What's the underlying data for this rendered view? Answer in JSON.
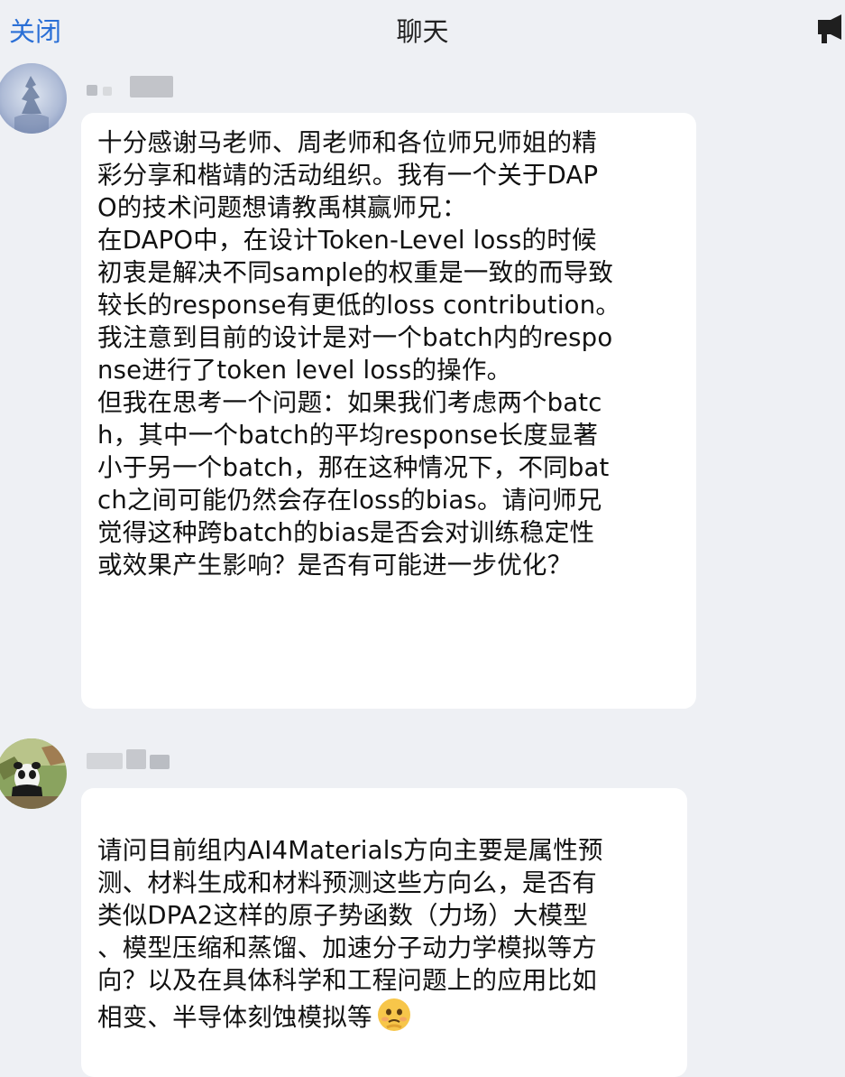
{
  "header": {
    "close_label": "关闭",
    "title": "聊天",
    "right_icon": "speaker-icon"
  },
  "messages": [
    {
      "avatar_icon": "avatar-image",
      "text": "十分感谢马老师、周老师和各位师兄师姐的精\n彩分享和楷靖的活动组织。我有一个关于DAP\nO的技术问题想请教禹棋赢师兄：\n在DAPO中，在设计Token-Level loss的时候\n初衷是解决不同sample的权重是一致的而导致\n较长的response有更低的loss contribution。\n我注意到目前的设计是对一个batch内的respo\nnse进行了token level loss的操作。\n但我在思考一个问题：如果我们考虑两个batc\nh，其中一个batch的平均response长度显著\n小于另一个batch，那在这种情况下，不同bat\nch之间可能仍然会存在loss的bias。请问师兄\n觉得这种跨batch的bias是否会对训练稳定性\n或效果产生影响？是否有可能进一步优化？"
    },
    {
      "avatar_icon": "panda-avatar",
      "text": "请问目前组内AI4Materials方向主要是属性预\n测、材料生成和材料预测这些方向么，是否有\n类似DPA2这样的原子势函数（力场）大模型\n、模型压缩和蒸馏、加速分子动力学模拟等方\n向？以及在具体科学和工程问题上的应用比如\n相变、半导体刻蚀模拟等",
      "trailing_emoji": "emoji-face-icon"
    }
  ],
  "colors": {
    "background": "#eef0f4",
    "bubble": "#ffffff",
    "link": "#2a6fd6"
  }
}
